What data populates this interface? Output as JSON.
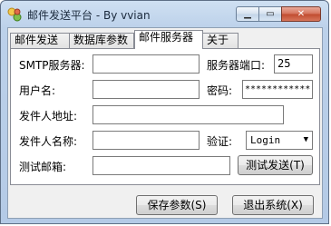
{
  "window": {
    "title": "邮件发送平台 - By vvian",
    "minimize_glyph": "▁",
    "maximize_glyph": "▭",
    "close_glyph": "✕"
  },
  "tabs": [
    {
      "label": "邮件发送"
    },
    {
      "label": "数据库参数"
    },
    {
      "label": "邮件服务器"
    },
    {
      "label": "关于"
    }
  ],
  "form": {
    "smtp_label": "SMTP服务器:",
    "smtp_value": "",
    "port_label": "服务器端口:",
    "port_value": "25",
    "username_label": "用户名:",
    "username_value": "",
    "password_label": "密码:",
    "password_value": "************",
    "sender_address_label": "发件人地址:",
    "sender_address_value": "",
    "sender_name_label": "发件人名称:",
    "sender_name_value": "",
    "auth_label": "验证:",
    "auth_value": "Login",
    "test_email_label": "测试邮箱:",
    "test_email_value": "",
    "test_send_button": "测试发送(T)"
  },
  "footer": {
    "save_button": "保存参数(S)",
    "exit_button": "退出系统(X)"
  },
  "icons": {
    "app": "mail-app-icon",
    "auth_dropdown": "chevron-down-icon"
  }
}
